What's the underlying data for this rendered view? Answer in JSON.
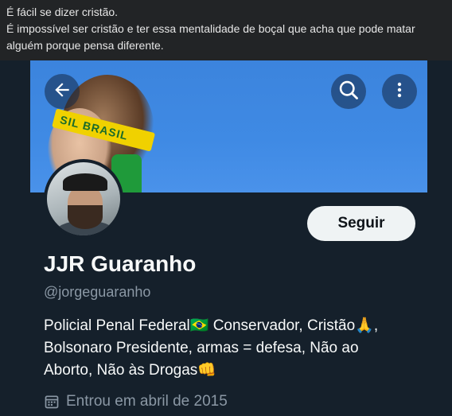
{
  "caption": {
    "line1": "É fácil se dizer cristão.",
    "line2": "É impossível ser cristão e ter essa mentalidade de boçal que acha que pode matar",
    "line3": "alguém porque pensa diferente."
  },
  "banner": {
    "headband_text": "SIL BRASIL"
  },
  "profile": {
    "follow_label": "Seguir",
    "name": "JJR Guaranho",
    "handle": "@jorgeguaranho",
    "bio_line1": "Policial Penal Federal🇧🇷 Conservador, Cristão🙏,",
    "bio_line2": "Bolsonaro Presidente, armas = defesa, Não ao",
    "bio_line3": "Aborto, Não às Drogas👊",
    "joined": "Entrou em abril de 2015"
  },
  "icons": {
    "back": "arrow-left-icon",
    "search": "search-icon",
    "more": "more-vertical-icon",
    "calendar": "calendar-icon"
  },
  "colors": {
    "background": "#15202b",
    "text_primary": "#f7f9f9",
    "text_secondary": "#8b98a5",
    "button_bg": "#eff3f4",
    "banner_blue": "#3f8ae4"
  }
}
